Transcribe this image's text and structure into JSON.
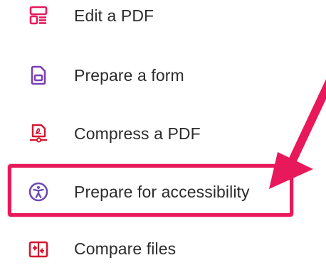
{
  "menu": {
    "items": [
      {
        "id": "edit",
        "label": "Edit a PDF",
        "icon": "edit-pdf-icon",
        "color": "#e8195b"
      },
      {
        "id": "form",
        "label": "Prepare a form",
        "icon": "prepare-form-icon",
        "color": "#7a3fb5"
      },
      {
        "id": "compress",
        "label": "Compress a PDF",
        "icon": "compress-pdf-icon",
        "color": "#d3172e"
      },
      {
        "id": "access",
        "label": "Prepare for accessibility",
        "icon": "accessibility-icon",
        "color": "#6b4bb3"
      },
      {
        "id": "compare",
        "label": "Compare files",
        "icon": "compare-files-icon",
        "color": "#d3172e"
      }
    ]
  },
  "annotation": {
    "highlight_color": "#e8195b",
    "arrow_color": "#e8195b"
  }
}
